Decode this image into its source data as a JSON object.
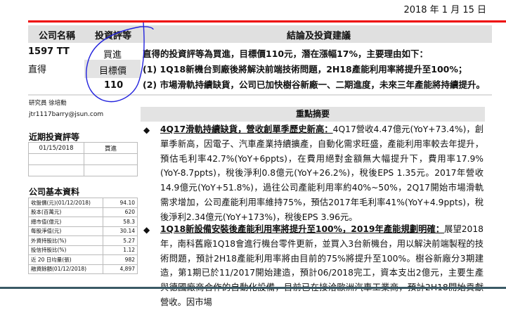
{
  "date": "2018 年 1 月 15 日",
  "header": {
    "company_name": "公司名稱",
    "rating": "投資評等",
    "conclusion": "結論及投資建議"
  },
  "company": {
    "ticker": "1597 TT",
    "name": "直得",
    "rating": "買進",
    "target_label": "目標價",
    "target_price": "110"
  },
  "conclusion_lines": [
    "直得的投資評等為買進，目標價110元，潛在漲幅17%，主要理由如下：",
    "(1) 1Q18新機台到廠後將解決前端技術問題，2H18產能利用率將提升至100%；",
    "(2) 市場滑軌持續缺貨，公司已加快樹谷新廠一、二期進度，未來三年產能將持續提升。"
  ],
  "analyst": {
    "label": "研究員 徐培勳",
    "email": "jtr1117barry@jsun.com"
  },
  "recent_ratings": {
    "title": "近期投資評等",
    "rows": [
      [
        "01/15/2018",
        "買進"
      ],
      [
        "",
        ""
      ],
      [
        "",
        ""
      ]
    ]
  },
  "basic_info": {
    "title": "公司基本資料",
    "rows": [
      [
        "收盤價(元)(01/12/2018)",
        "94.10"
      ],
      [
        "股本(百萬元)",
        "620"
      ],
      [
        "總市值(億元)",
        "58.3"
      ],
      [
        "每股淨值(元)",
        "30.14"
      ],
      [
        "外資持股比(%)",
        "5.27"
      ],
      [
        "投信持股比(%)",
        "1.12"
      ],
      [
        "近 20 日均量(張)",
        "982"
      ],
      [
        "融資餘額(01/12/2018)",
        "4,897"
      ]
    ]
  },
  "summary": {
    "title": "重點摘要",
    "bullets": [
      {
        "heading": "4Q17滑軌持續缺貨，營收創單季歷史新高：",
        "body": "4Q17營收4.47億元(YoY+73.4%)，創單季新高，因電子、汽車產業持續擴產，自動化需求旺盛，產能利用率較去年提升，預估毛利率42.7%(YoY+6ppts)，在費用絕對金額無大幅提升下，費用率17.9%(YoY-8.7ppts)，稅後淨利0.8億元(YoY+26.2%)，稅後EPS 1.35元。2017年營收14.9億元(YoY+51.8%)，過往公司產能利用率約40%~50%，2Q17開始市場滑軌需求增加，公司產能利用率維持75%，預估2017年毛利率41%(YoY+4.9ppts)，稅後淨利2.34億元(YoY+173%)，稅後EPS 3.96元。"
      },
      {
        "heading": "1Q18新設備安裝後產能利用率將提升至100%，2019年產能規劃明確：",
        "body": "展望2018年，南科舊廠1Q18會進行機台零件更新，並買入3台新機台，用以解決前端製程的技術問題，預計2H18產能利用率將由目前的75%將提升至100%。樹谷新廠分3期建造，第1期已於11/2017開始建造，預計06/2018完工，資本支出2億元，主要生產與德國廠商合作的自動化設備，目前已在接洽歐洲汽車工業商，預計2H18開始貢獻營收。因市場"
      }
    ]
  },
  "bullet_icon": "diamond-bullet-icon"
}
